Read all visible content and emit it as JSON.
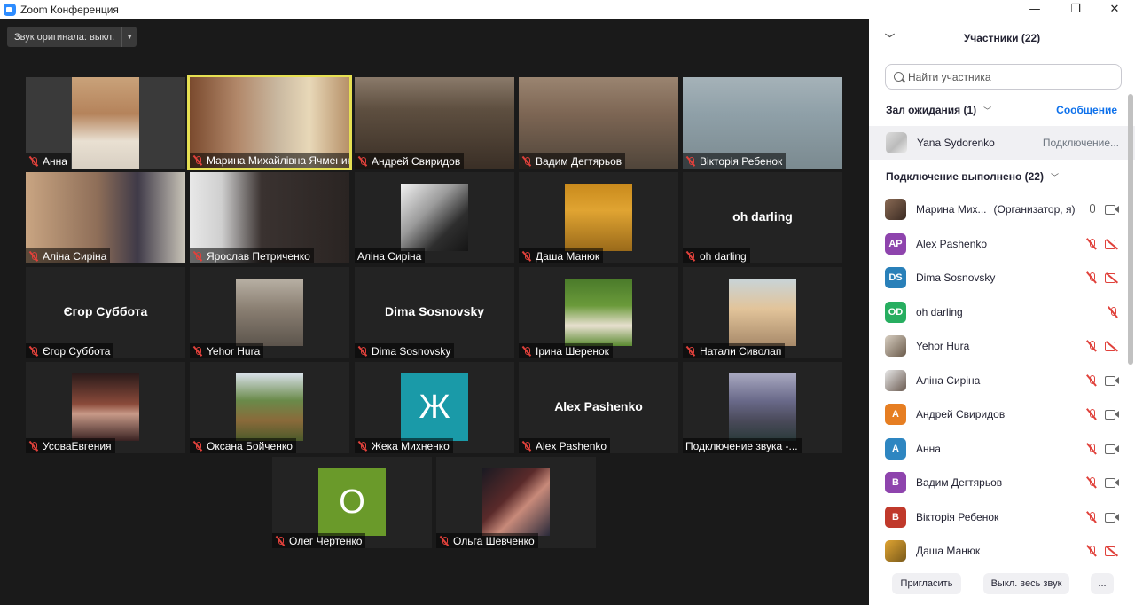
{
  "window": {
    "title": "Zoom Конференция",
    "minimize": "—",
    "maximize": "❐",
    "close": "✕"
  },
  "toolbar": {
    "original_sound": "Звук оригинала: выкл."
  },
  "tiles": [
    {
      "name": "Анна"
    },
    {
      "name": "Марина Михайлівна Ячменик"
    },
    {
      "name": "Андрей Свиридов"
    },
    {
      "name": "Вадим Дегтярьов"
    },
    {
      "name": "Вікторія Ребенок"
    },
    {
      "name": "Аліна Сиріна"
    },
    {
      "name": "Ярослав Петриченко"
    },
    {
      "name": "Аліна Сиріна"
    },
    {
      "name": "Даша Манюк"
    },
    {
      "name": "oh darling",
      "center_label": "oh darling"
    },
    {
      "name": "Єгор Суббота",
      "center_label": "Єгор Суббота"
    },
    {
      "name": "Yehor Hura"
    },
    {
      "name": "Dima Sosnovsky",
      "center_label": "Dima Sosnovsky"
    },
    {
      "name": "Ірина Шеренок"
    },
    {
      "name": "Натали Сиволап"
    },
    {
      "name": "УсоваЕвгения"
    },
    {
      "name": "Оксана Бойченко"
    },
    {
      "name": "Жека Михненко",
      "letter": "Ж"
    },
    {
      "name": "Alex Pashenko",
      "center_label": "Alex Pashenko"
    },
    {
      "name": "Подключение звука -..."
    },
    {
      "name": "Олег Чертенко",
      "letter": "О"
    },
    {
      "name": "Ольга Шевченко"
    }
  ],
  "panel": {
    "title": "Участники (22)",
    "search_placeholder": "Найти участника",
    "waiting_label": "Зал ожидания (1)",
    "message_label": "Сообщение",
    "waiting_user": {
      "name": "Yana Sydorenko",
      "status": "Подключение..."
    },
    "connected_label": "Подключение выполнено (22)",
    "participants": [
      {
        "name": "Марина Мих...",
        "extra": "(Организатор, я)",
        "initials": "",
        "color": "#7a5a44",
        "mic": "on",
        "cam": "on"
      },
      {
        "name": "Alex Pashenko",
        "initials": "AP",
        "color": "#8e44ad",
        "mic": "off",
        "cam": "off"
      },
      {
        "name": "Dima Sosnovsky",
        "initials": "DS",
        "color": "#2980b9",
        "mic": "off",
        "cam": "off"
      },
      {
        "name": "oh darling",
        "initials": "OD",
        "color": "#27ae60",
        "mic": "off",
        "cam": "none"
      },
      {
        "name": "Yehor Hura",
        "initials": "",
        "color": "#9c8a76",
        "mic": "off",
        "cam": "off"
      },
      {
        "name": "Аліна Сиріна",
        "initials": "",
        "color": "#b39b8a",
        "mic": "off",
        "cam": "on"
      },
      {
        "name": "Андрей Свиридов",
        "initials": "A",
        "color": "#e67e22",
        "mic": "off",
        "cam": "on"
      },
      {
        "name": "Анна",
        "initials": "A",
        "color": "#2e86c1",
        "mic": "off",
        "cam": "on"
      },
      {
        "name": "Вадим Дегтярьов",
        "initials": "B",
        "color": "#8e44ad",
        "mic": "off",
        "cam": "on"
      },
      {
        "name": "Вікторія Ребенок",
        "initials": "B",
        "color": "#c0392b",
        "mic": "off",
        "cam": "on"
      },
      {
        "name": "Даша Манюк",
        "initials": "",
        "color": "#b8862f",
        "mic": "off",
        "cam": "off"
      }
    ],
    "invite_button": "Пригласить",
    "mute_all_button": "Выкл. весь звук",
    "more_button": "..."
  }
}
